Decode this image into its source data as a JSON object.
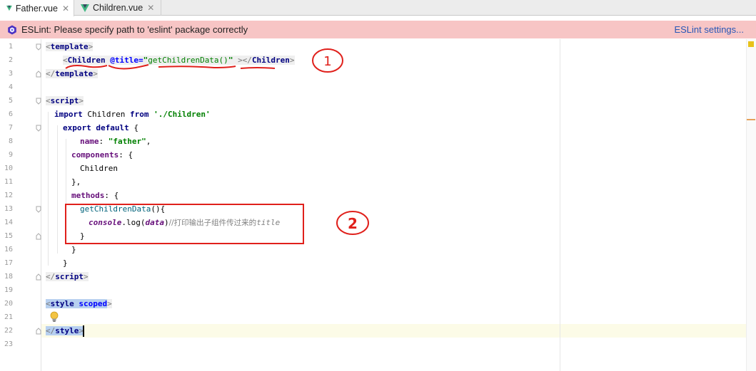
{
  "tabs": [
    {
      "label": "Father.vue",
      "close": "✕",
      "active": true
    },
    {
      "label": "Children.vue",
      "close": "✕",
      "active": false
    }
  ],
  "banner": {
    "message": "ESLint: Please specify path to 'eslint' package correctly",
    "link": "ESLint settings..."
  },
  "line_numbers": [
    "1",
    "2",
    "3",
    "4",
    "5",
    "6",
    "7",
    "8",
    "9",
    "10",
    "11",
    "12",
    "13",
    "14",
    "15",
    "16",
    "17",
    "18",
    "19",
    "20",
    "21",
    "22",
    "23"
  ],
  "code": {
    "l1_tag": "template",
    "l2_tag": "Children",
    "l2_attr": "@title=",
    "l2_q1": "\"",
    "l2_value": "getChildrenData()",
    "l2_q2": "\"",
    "l2_close": "Children",
    "l3_tag": "template",
    "l5_tag": "script",
    "l6_import": "import",
    "l6_name": "Children",
    "l6_from": "from",
    "l6_path": "'./Children'",
    "l7_export": "export default",
    "l7_brace": "{",
    "l8_key": "name",
    "l8_val": "\"father\"",
    "l9_key": "components",
    "l9_brace": "{",
    "l10_text": "Children",
    "l11_text": "},",
    "l12_key": "methods",
    "l12_brace": "{",
    "l13_fn": "getChildrenData",
    "l13_args": "(){",
    "l14_obj": "console",
    "l14_call": ".log(",
    "l14_param": "data",
    "l14_end": ")",
    "l14_comment_cn": "//打印输出子组件传过来的",
    "l14_comment_en": "title",
    "l15_text": "}",
    "l16_text": "}",
    "l17_text": "}",
    "l18_tag": "script",
    "l20_tag": "style",
    "l20_attr": "scoped",
    "l22_tag": "style"
  },
  "annotations": {
    "one": "1",
    "two": "2"
  },
  "colors": {
    "banner_bg": "#f7c5c5",
    "link": "#2857b6",
    "tag": "#000080",
    "string": "#008000",
    "annotation": "#e0201b"
  }
}
